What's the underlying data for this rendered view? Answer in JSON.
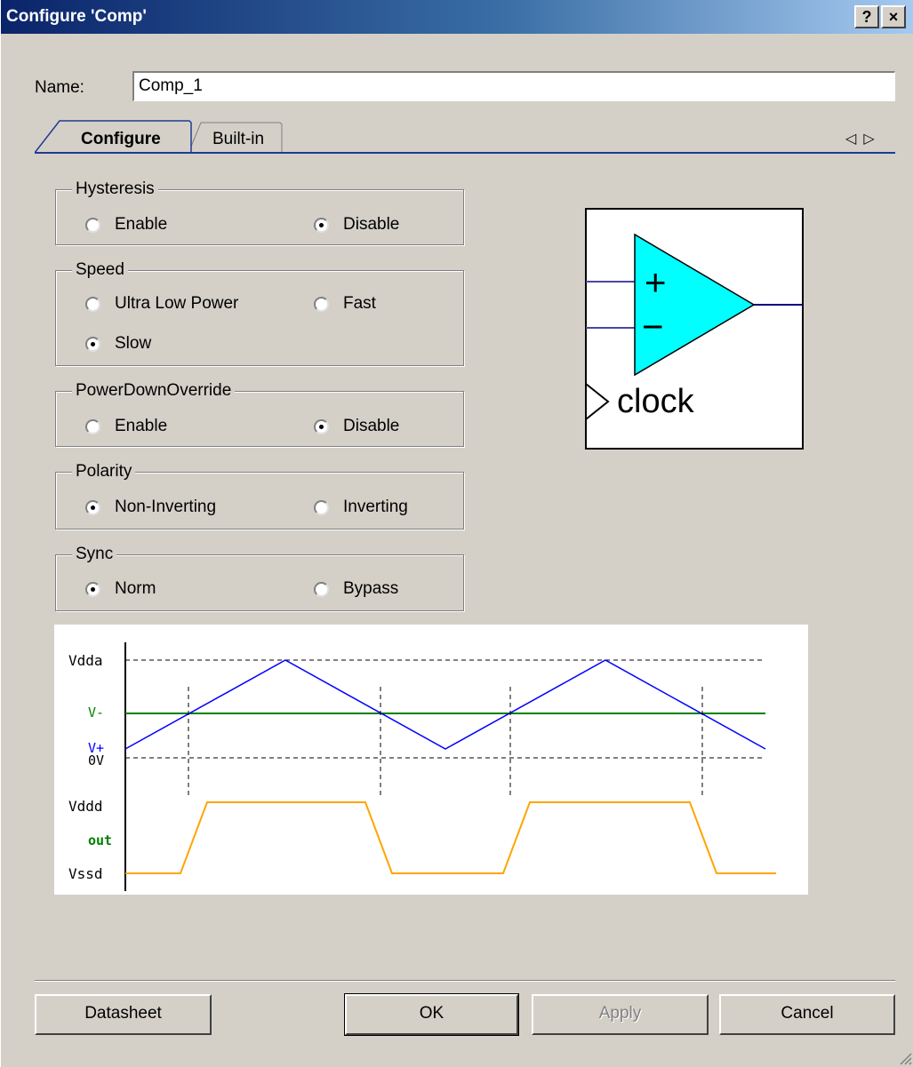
{
  "window": {
    "title": "Configure 'Comp'",
    "help_btn": "?",
    "close_btn": "×"
  },
  "name": {
    "label": "Name:",
    "value": "Comp_1"
  },
  "tabs": [
    {
      "label": "Configure",
      "active": true
    },
    {
      "label": "Built-in",
      "active": false
    }
  ],
  "tab_nav": {
    "left_icon": "arrow-left-icon",
    "right_icon": "arrow-right-icon"
  },
  "groups": {
    "hysteresis": {
      "title": "Hysteresis",
      "options": [
        "Enable",
        "Disable"
      ],
      "selected": "Disable"
    },
    "speed": {
      "title": "Speed",
      "options": [
        "Ultra Low Power",
        "Fast",
        "Slow"
      ],
      "selected": "Slow"
    },
    "powerdown": {
      "title": "PowerDownOverride",
      "options": [
        "Enable",
        "Disable"
      ],
      "selected": "Disable"
    },
    "polarity": {
      "title": "Polarity",
      "options": [
        "Non-Inverting",
        "Inverting"
      ],
      "selected": "Non-Inverting"
    },
    "sync": {
      "title": "Sync",
      "options": [
        "Norm",
        "Bypass"
      ],
      "selected": "Norm"
    }
  },
  "symbol": {
    "plus": "+",
    "minus": "−",
    "clock": "clock",
    "fill": "#00ffff"
  },
  "timing": {
    "labels": {
      "vdda": "Vdda",
      "vminus": "V-",
      "vplus": "V+",
      "zero": "0V",
      "vddd": "Vddd",
      "out": "out",
      "vssd": "Vssd"
    },
    "colors": {
      "vplus": "#0000ff",
      "vminus": "#008000",
      "out": "#ffa500"
    }
  },
  "buttons": {
    "datasheet": "Datasheet",
    "ok": "OK",
    "apply": "Apply",
    "cancel": "Cancel"
  },
  "colors": {
    "dialog_bg": "#d4d0c8",
    "title_start": "#0a246a",
    "title_end": "#a6caf0"
  }
}
